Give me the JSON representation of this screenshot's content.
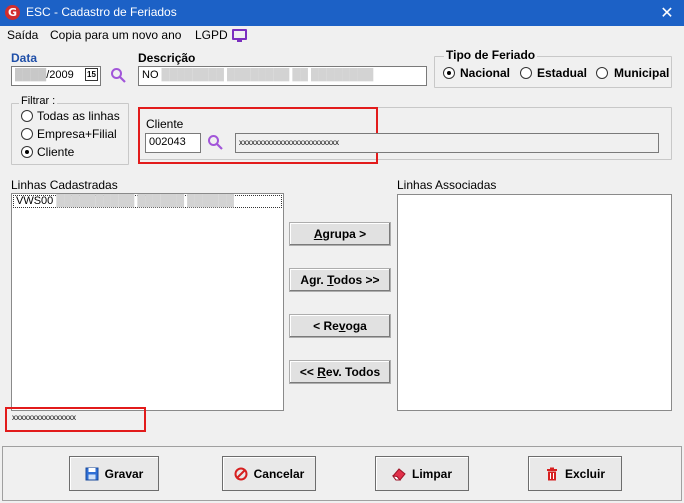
{
  "window": {
    "title": "ESC - Cadastro de Feriados",
    "logo_letter": "G"
  },
  "menu": {
    "items": [
      "Saída",
      "Copia para um novo ano",
      "LGPD"
    ]
  },
  "data_field": {
    "label": "Data",
    "value": "/2009",
    "calendar_badge": "15"
  },
  "descricao": {
    "label": "Descrição",
    "value": "NO"
  },
  "tipo_feriado": {
    "label": "Tipo de Feriado",
    "options": [
      "Nacional",
      "Estadual",
      "Municipal"
    ],
    "selected": "Nacional"
  },
  "filtrar": {
    "label": "Filtrar :",
    "options": [
      "Todas as linhas",
      "Empresa+Filial",
      "Cliente"
    ],
    "selected": "Cliente"
  },
  "cliente": {
    "label": "Cliente",
    "code": "002043",
    "name": "xxxxxxxxxxxxxxxxxxxxxxxxx"
  },
  "linhas_cadastradas": {
    "label": "Linhas Cadastradas",
    "items": [
      "VWS00"
    ]
  },
  "linhas_associadas": {
    "label": "Linhas Associadas",
    "items": []
  },
  "mid_buttons": {
    "agrupa": {
      "pre": "",
      "u": "A",
      "post": "grupa >"
    },
    "agr_todos": {
      "pre": "Agr. ",
      "u": "T",
      "post": "odos >>"
    },
    "revoga": {
      "pre": "< Re",
      "u": "v",
      "post": "oga"
    },
    "rev_todos": {
      "pre": "<< ",
      "u": "R",
      "post": "ev. Todos"
    }
  },
  "status_text": "xxxxxxxxxxxxxxxx",
  "footer": {
    "gravar": "Gravar",
    "cancelar": "Cancelar",
    "limpar": "Limpar",
    "excluir": "Excluir"
  },
  "colors": {
    "titlebar": "#1c61c6",
    "label_blue": "#1f4fa8",
    "highlight_red": "#e21b1b",
    "icon_purple": "#a256d9"
  }
}
